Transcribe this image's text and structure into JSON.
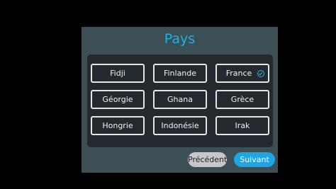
{
  "dialog": {
    "title": "Pays",
    "countries": [
      {
        "label": "Fidji",
        "selected": false
      },
      {
        "label": "Finlande",
        "selected": false
      },
      {
        "label": "France",
        "selected": true
      },
      {
        "label": "Géorgie",
        "selected": false
      },
      {
        "label": "Ghana",
        "selected": false
      },
      {
        "label": "Grèce",
        "selected": false
      },
      {
        "label": "Hongrie",
        "selected": false
      },
      {
        "label": "Indonésie",
        "selected": false
      },
      {
        "label": "Irak",
        "selected": false
      }
    ],
    "buttons": {
      "previous": "Précédent",
      "next": "Suivant"
    }
  },
  "colors": {
    "background": "#000000",
    "dialog": "#3b4f54",
    "panel": "#222a30",
    "accent": "#1fb0e8",
    "check": "#2fb3e6",
    "previous_button": "#c7c7c7",
    "next_button": "#1ea5e6"
  },
  "icons": {
    "selected_marker": "check-circle-icon"
  }
}
